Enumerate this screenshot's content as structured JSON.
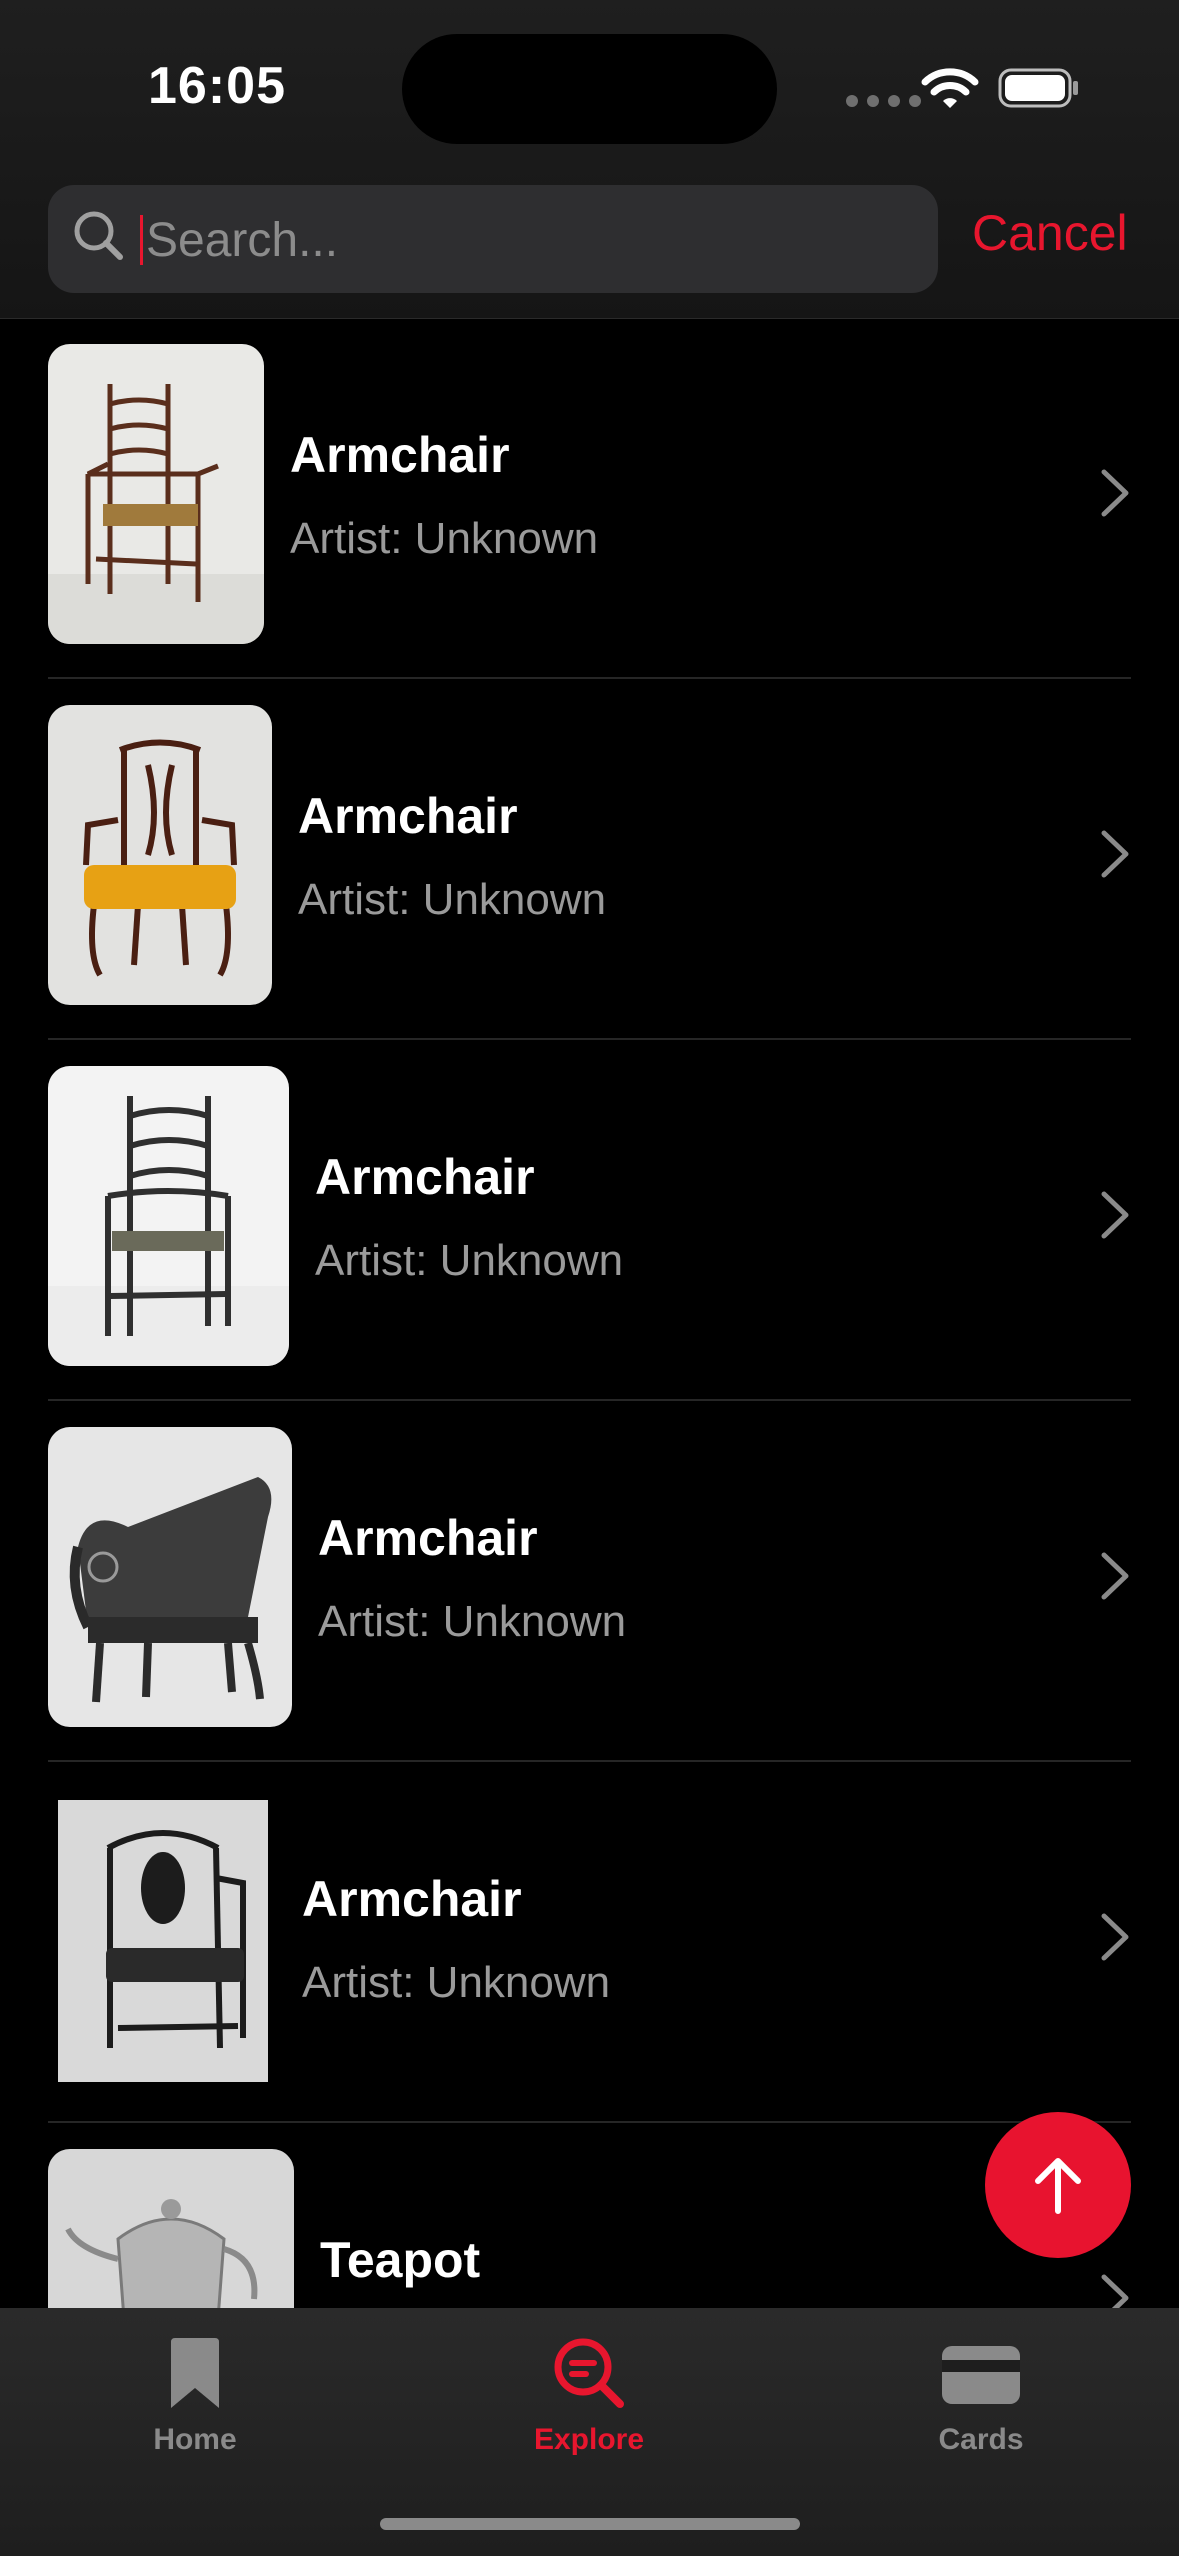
{
  "status_bar": {
    "time": "16:05"
  },
  "search": {
    "placeholder": "Search...",
    "value": "",
    "cancel_label": "Cancel"
  },
  "results": [
    {
      "title": "Armchair",
      "artist": "Artist: Unknown"
    },
    {
      "title": "Armchair",
      "artist": "Artist: Unknown"
    },
    {
      "title": "Armchair",
      "artist": "Artist: Unknown"
    },
    {
      "title": "Armchair",
      "artist": "Artist: Unknown"
    },
    {
      "title": "Armchair",
      "artist": "Artist: Unknown"
    },
    {
      "title": "Teapot",
      "artist": ""
    }
  ],
  "tabs": [
    {
      "label": "Home",
      "icon": "bookmark-icon",
      "active": false
    },
    {
      "label": "Explore",
      "icon": "explore-search-icon",
      "active": true
    },
    {
      "label": "Cards",
      "icon": "card-icon",
      "active": false
    }
  ],
  "colors": {
    "accent": "#e8162e",
    "background": "#000000",
    "secondary_text": "#9a9a9a"
  }
}
